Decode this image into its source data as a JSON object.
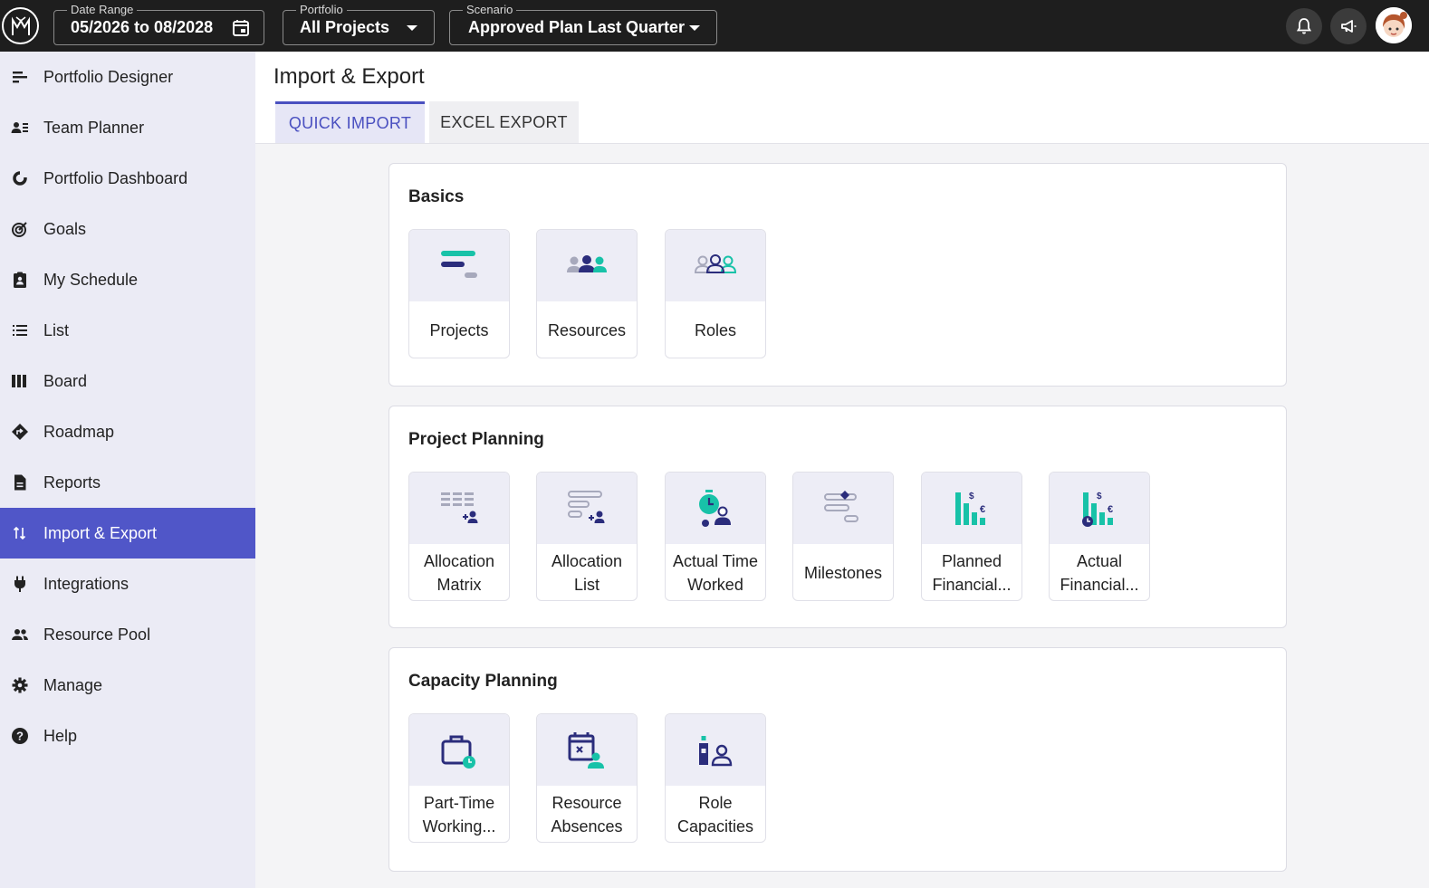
{
  "topbar": {
    "date_range": {
      "legend": "Date Range",
      "value": "05/2026 to 08/2028",
      "icon": "calendar-icon"
    },
    "portfolio": {
      "legend": "Portfolio",
      "value": "All Projects"
    },
    "scenario": {
      "legend": "Scenario",
      "value": "Approved Plan Last Quarter"
    },
    "icons": [
      "bell-icon",
      "megaphone-icon"
    ]
  },
  "sidebar": {
    "items": [
      {
        "label": "Portfolio Designer",
        "icon": "gantt-icon"
      },
      {
        "label": "Team Planner",
        "icon": "team-icon"
      },
      {
        "label": "Portfolio Dashboard",
        "icon": "donut-chart-icon"
      },
      {
        "label": "Goals",
        "icon": "target-icon"
      },
      {
        "label": "My Schedule",
        "icon": "clipboard-user-icon"
      },
      {
        "label": "List",
        "icon": "list-icon"
      },
      {
        "label": "Board",
        "icon": "board-icon"
      },
      {
        "label": "Roadmap",
        "icon": "road-sign-icon"
      },
      {
        "label": "Reports",
        "icon": "document-icon"
      },
      {
        "label": "Import & Export",
        "icon": "import-export-icon",
        "active": true
      },
      {
        "label": "Integrations",
        "icon": "plug-icon"
      },
      {
        "label": "Resource Pool",
        "icon": "people-icon"
      },
      {
        "label": "Manage",
        "icon": "gear-icon"
      },
      {
        "label": "Help",
        "icon": "help-icon"
      }
    ]
  },
  "main": {
    "title": "Import & Export",
    "tabs": [
      {
        "label": "QUICK IMPORT",
        "active": true
      },
      {
        "label": "EXCEL EXPORT",
        "active": false
      }
    ],
    "sections": [
      {
        "title": "Basics",
        "tiles": [
          {
            "label": "Projects",
            "icon": "projects-icon"
          },
          {
            "label": "Resources",
            "icon": "resources-icon"
          },
          {
            "label": "Roles",
            "icon": "roles-icon"
          }
        ]
      },
      {
        "title": "Project Planning",
        "tiles": [
          {
            "label": "Allocation Matrix",
            "icon": "allocation-matrix-icon"
          },
          {
            "label": "Allocation List",
            "icon": "allocation-list-icon"
          },
          {
            "label": "Actual Time Worked",
            "icon": "actual-time-icon"
          },
          {
            "label": "Milestones",
            "icon": "milestones-icon"
          },
          {
            "label": "Planned Financial...",
            "icon": "planned-financial-icon"
          },
          {
            "label": "Actual Financial...",
            "icon": "actual-financial-icon"
          }
        ]
      },
      {
        "title": "Capacity Planning",
        "tiles": [
          {
            "label": "Part-Time Working...",
            "icon": "part-time-icon"
          },
          {
            "label": "Resource Absences",
            "icon": "absence-icon"
          },
          {
            "label": "Role Capacities",
            "icon": "role-capacity-icon"
          }
        ]
      }
    ]
  },
  "colors": {
    "topbar": "#1e1e1e",
    "sidebar": "#ebebf5",
    "accent": "#5056c8",
    "icon_navy": "#2b2d7c",
    "icon_teal": "#18c2a8",
    "icon_grey": "#a7a9bc"
  }
}
